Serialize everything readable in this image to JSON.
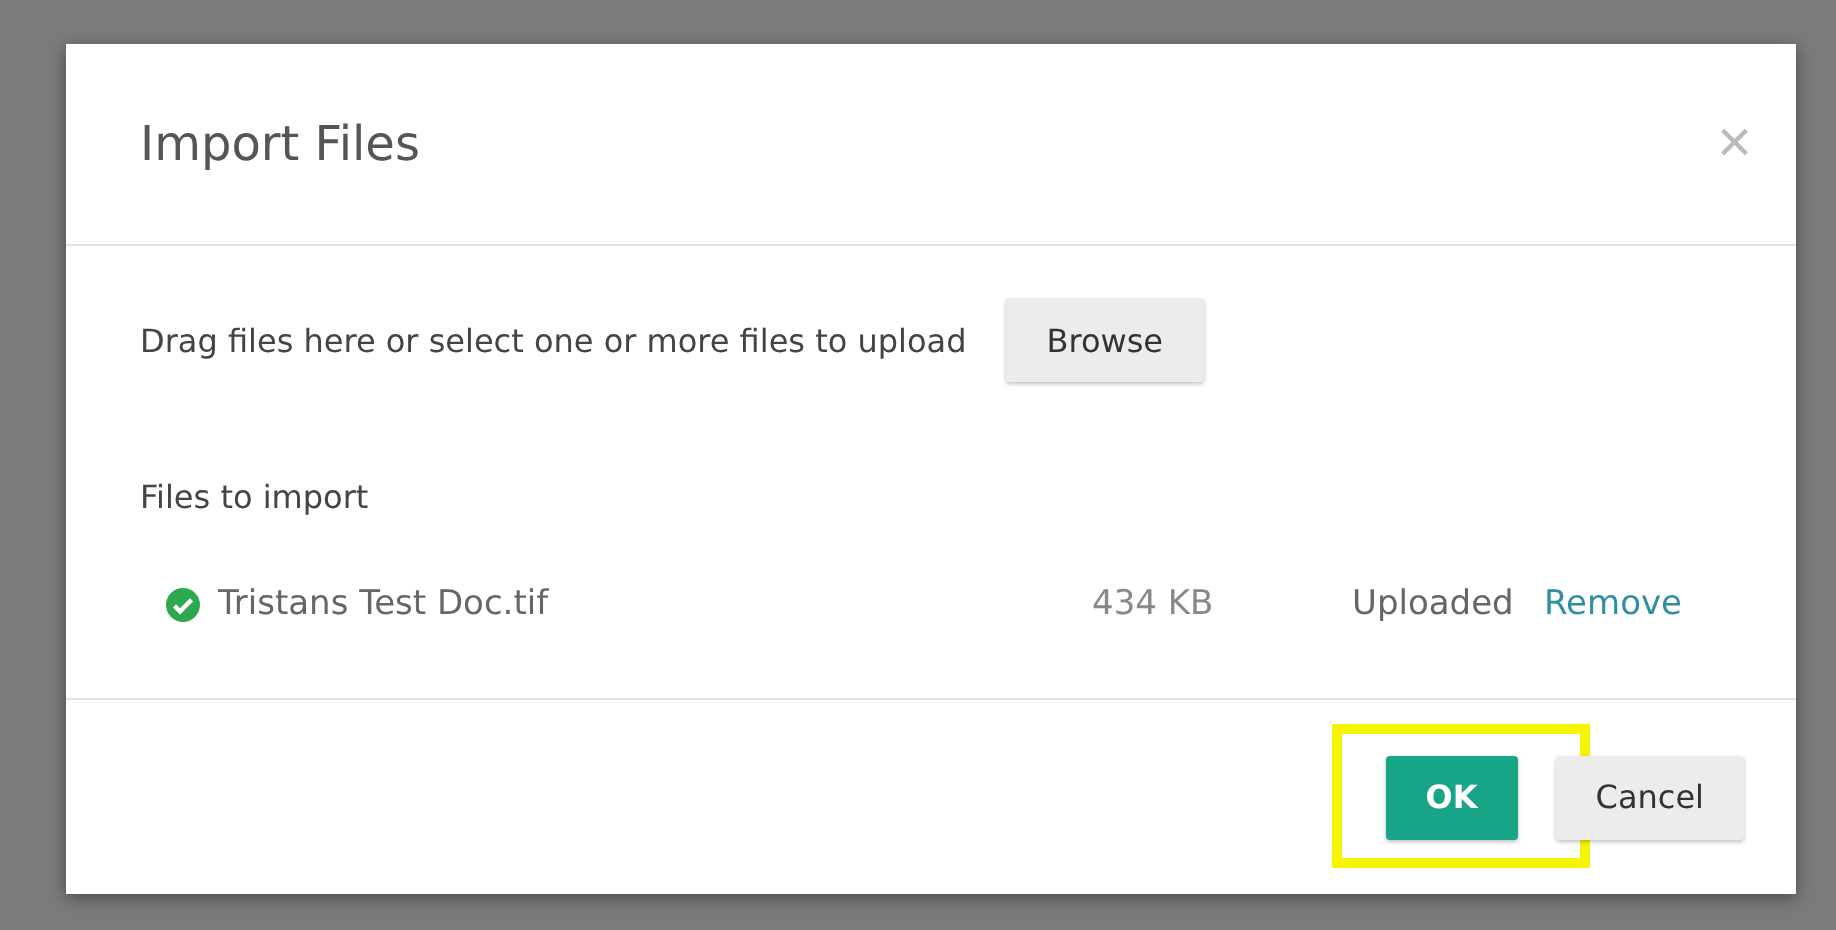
{
  "dialog": {
    "title": "Import Files",
    "close": "×"
  },
  "instructions": "Drag files here or select one or more files to upload",
  "browse_button": "Browse",
  "files_heading": "Files to import",
  "files": [
    {
      "name": "Tristans Test Doc.tif",
      "size": "434 KB",
      "status": "Uploaded",
      "action": "Remove",
      "uploaded": true
    }
  ],
  "buttons": [
    {
      "label": "OK",
      "kind": "primary",
      "highlighted": true
    },
    {
      "label": "Cancel",
      "kind": "secondary",
      "highlighted": false
    }
  ]
}
